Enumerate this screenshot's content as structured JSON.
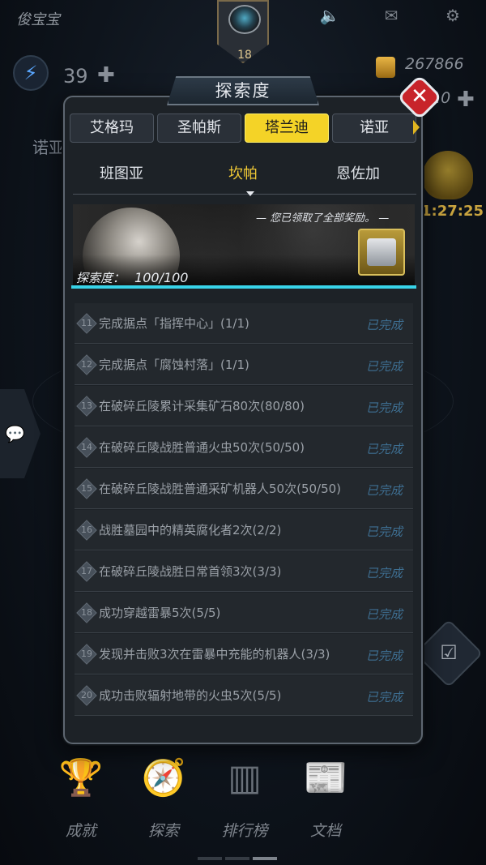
{
  "hud": {
    "username": "俊宝宝",
    "level": "18",
    "energy": "39",
    "coins": "267866",
    "right_value": "10",
    "side_label": "诺亚",
    "timer": "1:27:25"
  },
  "modal": {
    "title": "探索度",
    "regions": [
      {
        "label": "艾格玛",
        "active": false
      },
      {
        "label": "圣帕斯",
        "active": false
      },
      {
        "label": "塔兰迪",
        "active": true
      },
      {
        "label": "诺亚",
        "active": false
      }
    ],
    "planets": [
      {
        "label": "班图亚",
        "active": false
      },
      {
        "label": "坎帕",
        "active": true
      },
      {
        "label": "恩佐加",
        "active": false
      }
    ],
    "banner": {
      "reward_text": "— 您已领取了全部奖励。 —",
      "explore_label": "探索度：",
      "explore_value": "100/100",
      "progress": 1.0
    },
    "quests": [
      {
        "num": "11",
        "text": "完成据点「指挥中心」(1/1)",
        "status": "已完成"
      },
      {
        "num": "12",
        "text": "完成据点「腐蚀村落」(1/1)",
        "status": "已完成"
      },
      {
        "num": "13",
        "text": "在破碎丘陵累计采集矿石80次(80/80)",
        "status": "已完成"
      },
      {
        "num": "14",
        "text": "在破碎丘陵战胜普通火虫50次(50/50)",
        "status": "已完成"
      },
      {
        "num": "15",
        "text": "在破碎丘陵战胜普通采矿机器人50次(50/50)",
        "status": "已完成"
      },
      {
        "num": "16",
        "text": "战胜墓园中的精英腐化者2次(2/2)",
        "status": "已完成"
      },
      {
        "num": "17",
        "text": "在破碎丘陵战胜日常首领3次(3/3)",
        "status": "已完成"
      },
      {
        "num": "18",
        "text": "成功穿越雷暴5次(5/5)",
        "status": "已完成"
      },
      {
        "num": "19",
        "text": "发现并击败3次在雷暴中充能的机器人(3/3)",
        "status": "已完成"
      },
      {
        "num": "20",
        "text": "成功击败辐射地带的火虫5次(5/5)",
        "status": "已完成"
      }
    ]
  },
  "bottom_nav": [
    {
      "label": "成就",
      "icon": "trophy-icon"
    },
    {
      "label": "探索",
      "icon": "compass-icon"
    },
    {
      "label": "排行榜",
      "icon": "podium-icon"
    },
    {
      "label": "文档",
      "icon": "document-icon"
    }
  ]
}
